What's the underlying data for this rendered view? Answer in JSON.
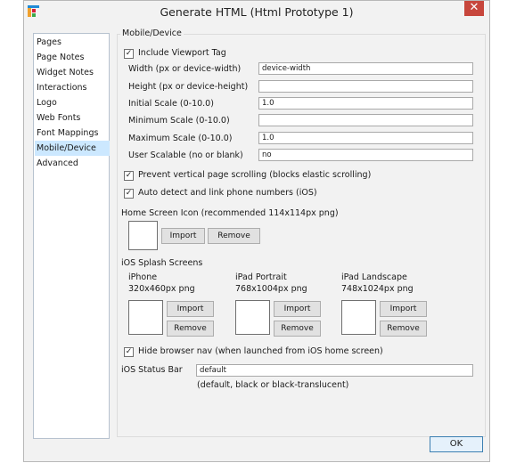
{
  "window": {
    "title": "Generate HTML (Html Prototype 1)",
    "close_glyph": "✕"
  },
  "nav": {
    "items": [
      "Pages",
      "Page Notes",
      "Widget Notes",
      "Interactions",
      "Logo",
      "Web Fonts",
      "Font Mappings",
      "Mobile/Device",
      "Advanced"
    ],
    "selected": "Mobile/Device"
  },
  "section": {
    "title": "Mobile/Device"
  },
  "viewport": {
    "include_label": "Include Viewport Tag",
    "include_checked": true,
    "width_label": "Width (px or device-width)",
    "width_value": "device-width",
    "height_label": "Height (px or device-height)",
    "height_value": "",
    "initial_scale_label": "Initial Scale (0-10.0)",
    "initial_scale_value": "1.0",
    "min_scale_label": "Minimum Scale (0-10.0)",
    "min_scale_value": "",
    "max_scale_label": "Maximum Scale (0-10.0)",
    "max_scale_value": "1.0",
    "scalable_label": "User Scalable (no or blank)",
    "scalable_value": "no"
  },
  "options": {
    "prevent_scroll_label": "Prevent vertical page scrolling (blocks elastic scrolling)",
    "prevent_scroll_checked": true,
    "auto_detect_label": "Auto detect and link phone numbers (iOS)",
    "auto_detect_checked": true,
    "hide_nav_label": "Hide browser nav (when launched from iOS home screen)",
    "hide_nav_checked": true
  },
  "home_icon": {
    "label": "Home Screen Icon (recommended 114x114px png)"
  },
  "splash": {
    "label": "iOS Splash Screens",
    "iphone": {
      "name": "iPhone",
      "size": "320x460px png"
    },
    "ipad_portrait": {
      "name": "iPad Portrait",
      "size": "768x1004px png"
    },
    "ipad_landscape": {
      "name": "iPad Landscape",
      "size": "748x1024px png"
    }
  },
  "buttons": {
    "import": "Import",
    "remove": "Remove",
    "ok": "OK"
  },
  "status_bar": {
    "label": "iOS Status Bar",
    "value": "default",
    "hint": "(default, black or black-translucent)"
  },
  "check_glyph": "✓"
}
